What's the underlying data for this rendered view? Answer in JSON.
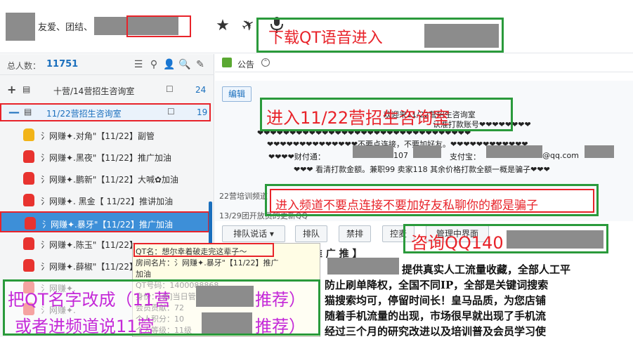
{
  "header": {
    "motto": "友爱、团结、",
    "qt_banner_text": "下载QT语音进入",
    "icons": [
      "star-icon",
      "airplane-icon",
      "microphone-icon"
    ]
  },
  "sidebar": {
    "total_label": "总人数：",
    "total_value": "11751",
    "tool_icons": [
      "list-icon",
      "location-icon",
      "user-icon",
      "search-icon",
      "edit-icon"
    ],
    "channels": [
      {
        "expander": "+",
        "name": "十营/14营招生咨询室",
        "count": "24"
      },
      {
        "expander": "—",
        "name": "11/22营招生咨询室",
        "count": "19"
      }
    ],
    "users": [
      {
        "name": "氵网赚✦.对角\"【11/22】副管",
        "color": "#f2b418"
      },
      {
        "name": "氵网赚✦.黑夜\"【11/22】推广加油",
        "color": "#e8332f"
      },
      {
        "name": "氵网赚✦.鹏新\"【11/22】大喊✿加油",
        "color": "#e8332f"
      },
      {
        "name": "氵网赚✦.  黑金【 11/22】推讲加油",
        "color": "#e8332f"
      },
      {
        "name": "氵网赚✦.暴牙\"【11/22】推广加油",
        "color": "#e8332f"
      },
      {
        "name": "氵网赚✦.陈玉\"【11/22】",
        "color": "#e8332f"
      },
      {
        "name": "氵网赚✦.薛椒\"【11/22】",
        "color": "#e8332f"
      },
      {
        "name": "氵网赚✦.",
        "color": "#e8332f"
      },
      {
        "name": "氵网赚✦.",
        "color": "#e8332f"
      }
    ]
  },
  "tooltip": {
    "lines": [
      "QT名：想尔幸着破走完这辈子～",
      "房间名片：氵网赚✦.暴牙\"【11/22】推广",
      "加油",
      "QT号码：1400088868",
      "身份：[会]当日管理员",
      "会员贡献：72",
      "个人积分：10",
      "个人等级：11级"
    ]
  },
  "notice": {
    "label": "公告",
    "edit_label": "编辑",
    "welcome": "欢迎来11/22营招生咨询室",
    "welcome_sub": "认准打款账号❤❤❤❤❤❤❤❤",
    "line_hearts": "❤❤❤❤❤❤❤❤❤❤❤❤❤❤❤❤❤❤❤❤❤❤❤❤❤❤❤❤❤❤❤❤❤",
    "line_warning": "❤❤❤❤❤❤❤❤❤❤❤❤❤❤不要点连接，不要加好友。❤❤❤❤❤❤❤❤❤❤❤❤",
    "line_pay_prefix": "❤❤❤❤财付通：",
    "line_pay_mid": "107",
    "line_pay_alipay": "支付宝：",
    "line_pay_email": "@qq.com",
    "line_reminder": "❤❤❤ 看清打款金额。兼职99  卖家118  其余价格打款全额一概是骗子❤❤❤",
    "training_hint": "22营培训频道",
    "open_hint": "13/29团开放员的更新QQ",
    "channel_warning": "进入频道不要点连接不要加好友私聊你的都是骗子"
  },
  "actions": {
    "queue_speech": "排队说话",
    "queue": "排队",
    "ban_queue": "禁排",
    "control_mic": "控麦",
    "speaking_label": "管理中界面"
  },
  "ad": {
    "heading": "【 推 广 推 】",
    "line1_suffix": "提供真实人工流量收藏，全部人工平",
    "line2": "防止刷单降权，全国不同IP，全部是关键词搜索",
    "line3": "猫搜索均可，停留时间长！皇马品质，为您店铺",
    "line4": "随着手机流量的出现，市场很早就出现了手机流",
    "line5": "经过三个月的研究改进以及培训普及会员学习使"
  },
  "annotations": {
    "enter_room": "进入11/22营招生咨询室",
    "consult_qq": "咨询QQ140",
    "rename_qt": "把QT名字改成（11营",
    "recommend": "推荐）",
    "or_enter": "或者进频道说11营"
  },
  "colors": {
    "accent": "#1a6fbd",
    "annotation_red": "#e8232a",
    "annotation_green": "#2a9a3b",
    "redaction": "#8c8c8c"
  }
}
